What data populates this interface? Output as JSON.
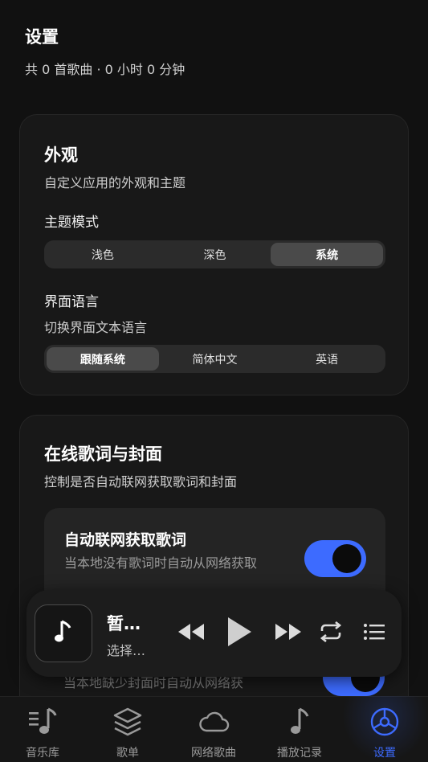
{
  "header": {
    "title": "设置",
    "summary": "共 0 首歌曲 · 0 小时 0 分钟"
  },
  "appearance": {
    "title": "外观",
    "description": "自定义应用的外观和主题",
    "theme_label": "主题模式",
    "theme_options": [
      "浅色",
      "深色",
      "系统"
    ],
    "theme_selected": "系统",
    "language_label": "界面语言",
    "language_description": "切换界面文本语言",
    "language_options": [
      "跟随系统",
      "简体中文",
      "英语"
    ],
    "language_selected": "跟随系统"
  },
  "online": {
    "title": "在线歌词与封面",
    "description": "控制是否自动联网获取歌词和封面",
    "lyrics_title": "自动联网获取歌词",
    "lyrics_desc": "当本地没有歌词时自动从网络获取",
    "lyrics_enabled": true,
    "cover_desc_partial": "当本地缺少封面时自动从网络获",
    "cover_enabled": true
  },
  "player": {
    "title": "暂…",
    "subtitle": "选择…",
    "cover_icon": "music-note-icon"
  },
  "tabs": [
    {
      "label": "音乐库",
      "icon": "library-icon"
    },
    {
      "label": "歌单",
      "icon": "layers-icon"
    },
    {
      "label": "网络歌曲",
      "icon": "cloud-icon"
    },
    {
      "label": "播放记录",
      "icon": "music-note-icon"
    },
    {
      "label": "设置",
      "icon": "settings-icon",
      "active": true
    }
  ],
  "colors": {
    "accent": "#3d6bff",
    "background": "#111111",
    "card": "#181818"
  }
}
